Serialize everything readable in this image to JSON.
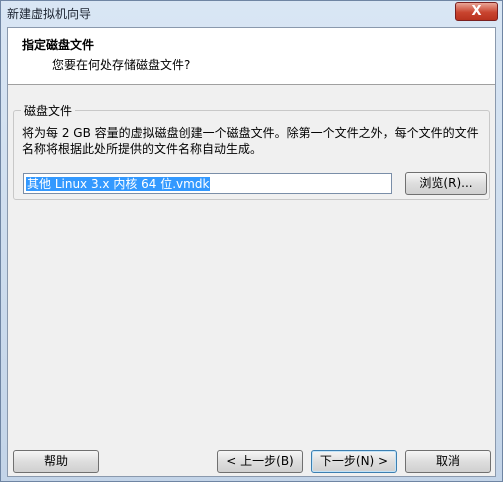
{
  "window": {
    "title": "新建虚拟机向导",
    "close_label": "X"
  },
  "header": {
    "title": "指定磁盘文件",
    "subtitle": "您要在何处存储磁盘文件?"
  },
  "disk_file": {
    "group_label": "磁盘文件",
    "description": "将为每 2 GB 容量的虚拟磁盘创建一个磁盘文件。除第一个文件之外，每个文件的文件名称将根据此处所提供的文件名称自动生成。",
    "filename": "其他 Linux 3.x 内核 64 位.vmdk",
    "browse_label": "浏览(R)..."
  },
  "footer": {
    "help_label": "帮助",
    "back_label": "< 上一步(B)",
    "next_label": "下一步(N) >",
    "cancel_label": "取消"
  },
  "colors": {
    "selection": "#3399ff",
    "close_button": "#c9442f"
  }
}
